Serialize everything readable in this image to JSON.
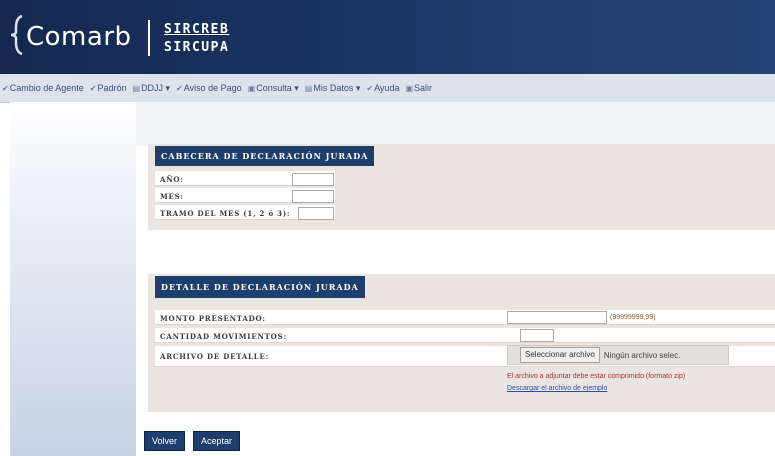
{
  "header": {
    "logo_text": "Comarb",
    "sub_line1": "SIRCREB",
    "sub_line2": "SIRCUPA"
  },
  "nav": {
    "items": [
      {
        "label": "Cambio de Agente",
        "icon": "check-icon"
      },
      {
        "label": "Padrón",
        "icon": "check-icon"
      },
      {
        "label": "DDJJ ▾",
        "icon": "doc-icon"
      },
      {
        "label": "Aviso de Pago",
        "icon": "check-icon"
      },
      {
        "label": "Consulta ▾",
        "icon": "search-icon"
      },
      {
        "label": "Mis Datos ▾",
        "icon": "user-icon"
      },
      {
        "label": "Ayuda",
        "icon": "help-icon"
      },
      {
        "label": "Salir",
        "icon": "exit-icon"
      }
    ]
  },
  "cabecera": {
    "title": "CABECERA DE DECLARACIÓN JURADA",
    "anio_label": "AÑO:",
    "mes_label": "MES:",
    "tramo_label": "TRAMO DEL MES (1, 2 ó 3):",
    "anio_value": "",
    "mes_value": "",
    "tramo_value": ""
  },
  "detalle": {
    "title": "DETALLE DE DECLARACIÓN JURADA",
    "monto_label": "MONTO PRESENTADO:",
    "monto_value": "",
    "monto_hint": "(99999999,99)",
    "cantidad_label": "CANTIDAD MOVIMIENTOS:",
    "cantidad_value": "",
    "archivo_label": "ARCHIVO DE DETALLE:",
    "file_button": "Seleccionar archivo",
    "file_status": "Ningún archivo selec.",
    "warning": "El archivo a adjuntar debe estar comprimido (formato zip)",
    "link": "Descargar el archivo de ejemplo"
  },
  "actions": {
    "volver": "Volver",
    "aceptar": "Aceptar"
  },
  "colors": {
    "header_bg": "#1b3564",
    "section_title_bg": "#1e3e6c",
    "section_bg": "#ebe5e2"
  }
}
